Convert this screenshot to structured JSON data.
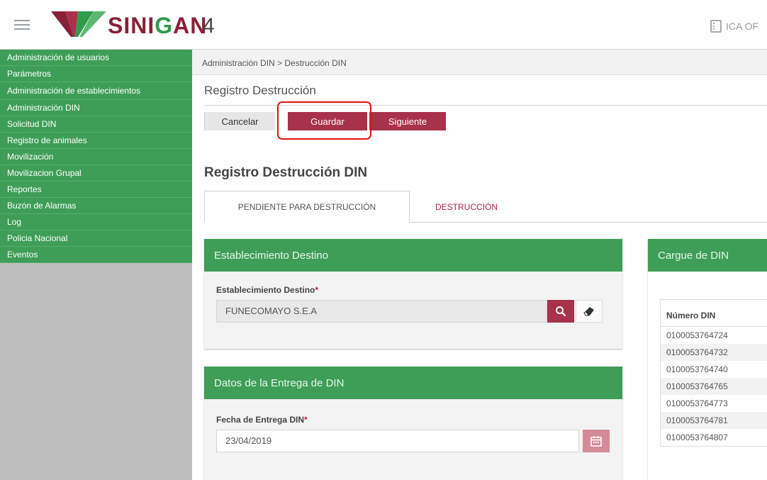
{
  "header": {
    "brand_prefix": "SINI",
    "brand_g": "G",
    "brand_suffix": "AN",
    "version": "4",
    "org_text": "ICA OF"
  },
  "sidebar": {
    "items": [
      {
        "label": "Administración de usuarios"
      },
      {
        "label": "Parámetros"
      },
      {
        "label": "Administración de establecimientos"
      },
      {
        "label": "Administración DIN"
      },
      {
        "label": "Solicitud DIN"
      },
      {
        "label": "Registro de animales"
      },
      {
        "label": "Movilización"
      },
      {
        "label": "Movilizacion Grupal"
      },
      {
        "label": "Reportes"
      },
      {
        "label": "Buzón de Alarmas"
      },
      {
        "label": "Log"
      },
      {
        "label": "Policia Nacional"
      },
      {
        "label": "Eventos"
      }
    ]
  },
  "breadcrumb": "Administración DIN > Destrucción DIN",
  "page_subtitle": "Registro Destrucción",
  "toolbar": {
    "cancel_label": "Cancelar",
    "save_label": "Guardar",
    "next_label": "Siguiente"
  },
  "section_title": "Registro Destrucción DIN",
  "tabs": [
    {
      "label": "PENDIENTE PARA DESTRUCCIÓN",
      "active": true
    },
    {
      "label": "DESTRUCCIÓN",
      "active": false
    }
  ],
  "panel_establecimiento": {
    "title": "Establecimiento Destino",
    "field_label": "Establecimiento Destino",
    "required_mark": "*",
    "value": "FUNECOMAYO S.E.A"
  },
  "panel_entrega": {
    "title": "Datos de la Entrega de DIN",
    "field_label": "Fecha de Entrega DIN",
    "required_mark": "*",
    "value": "23/04/2019"
  },
  "panel_cargue": {
    "title": "Cargue de DIN",
    "column_header": "Número DIN",
    "rows": [
      "0100053764724",
      "0100053764732",
      "0100053764740",
      "0100053764765",
      "0100053764773",
      "0100053764781",
      "0100053764807"
    ]
  },
  "colors": {
    "primary_green": "#3e9e57",
    "accent_maroon": "#a8324a",
    "highlight_red": "#e01414"
  },
  "icons": {
    "menu": "hamburger-icon",
    "logo": "sinigan-logo",
    "org": "building-icon",
    "search": "search-icon",
    "eraser": "eraser-icon",
    "calendar": "calendar-icon"
  }
}
